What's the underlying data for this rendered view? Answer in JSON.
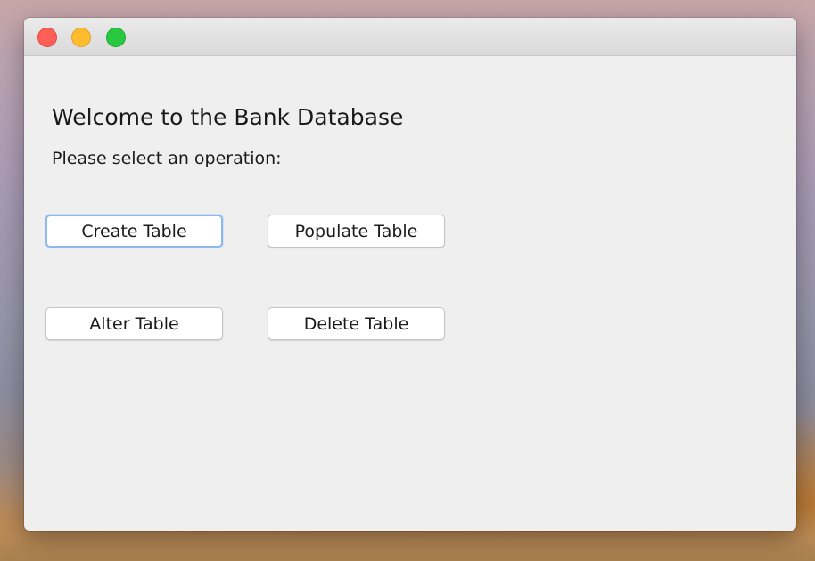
{
  "window": {
    "controls": {
      "close_color": "#fe5f57",
      "minimize_color": "#febc2e",
      "maximize_color": "#28c840"
    }
  },
  "main": {
    "heading": "Welcome to the Bank Database",
    "subheading": "Please select an operation:",
    "buttons": {
      "create": "Create Table",
      "populate": "Populate Table",
      "alter": "Alter Table",
      "delete": "Delete Table"
    },
    "focused_button": "create"
  }
}
